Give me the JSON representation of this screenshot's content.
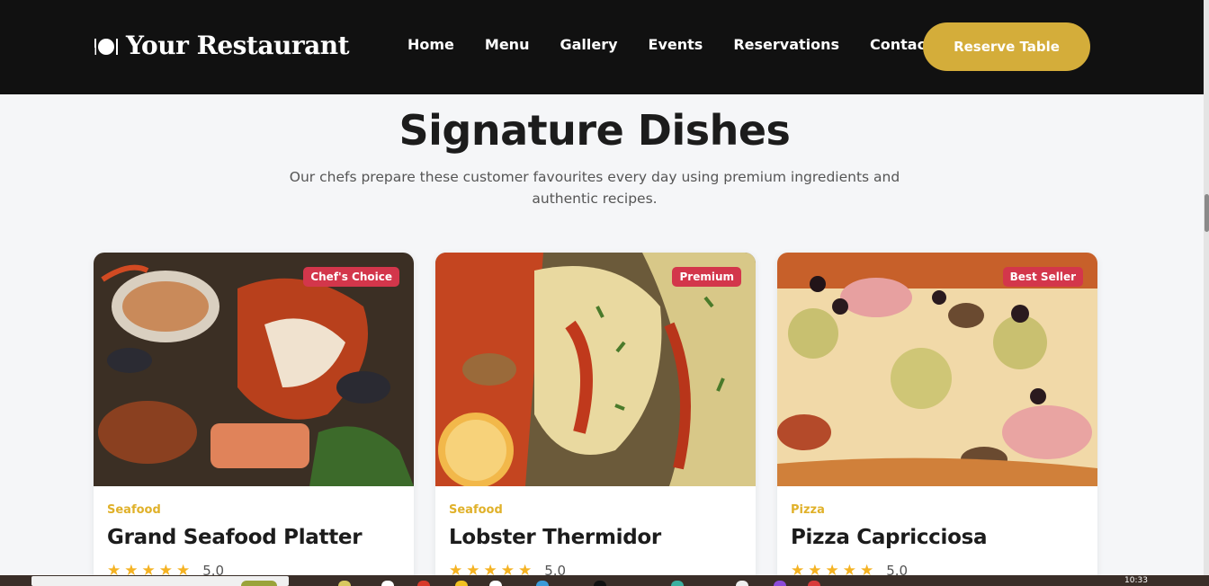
{
  "brand": {
    "name": "Your Restaurant",
    "icon": "plate-cutlery-icon"
  },
  "nav": {
    "links": [
      "Home",
      "Menu",
      "Gallery",
      "Events",
      "Reservations",
      "Contact"
    ],
    "cta": "Reserve Table"
  },
  "section": {
    "title": "Signature Dishes",
    "subtitle": "Our chefs prepare these customer favourites every day using premium ingredients and authentic recipes."
  },
  "cards": [
    {
      "badge": "Chef's Choice",
      "category": "Seafood",
      "name": "Grand Seafood Platter",
      "rating": "5.0",
      "stars": 5
    },
    {
      "badge": "Premium",
      "category": "Seafood",
      "name": "Lobster Thermidor",
      "rating": "5.0",
      "stars": 5
    },
    {
      "badge": "Best Seller",
      "category": "Pizza",
      "name": "Pizza Capricciosa",
      "rating": "5.0",
      "stars": 5
    }
  ],
  "taskbar": {
    "time": "10:33"
  },
  "colors": {
    "nav_bg": "#111111",
    "accent_gold": "#d4ad3a",
    "badge_red": "#d3364b",
    "category_gold": "#e0b12a",
    "star": "#f5b323"
  }
}
